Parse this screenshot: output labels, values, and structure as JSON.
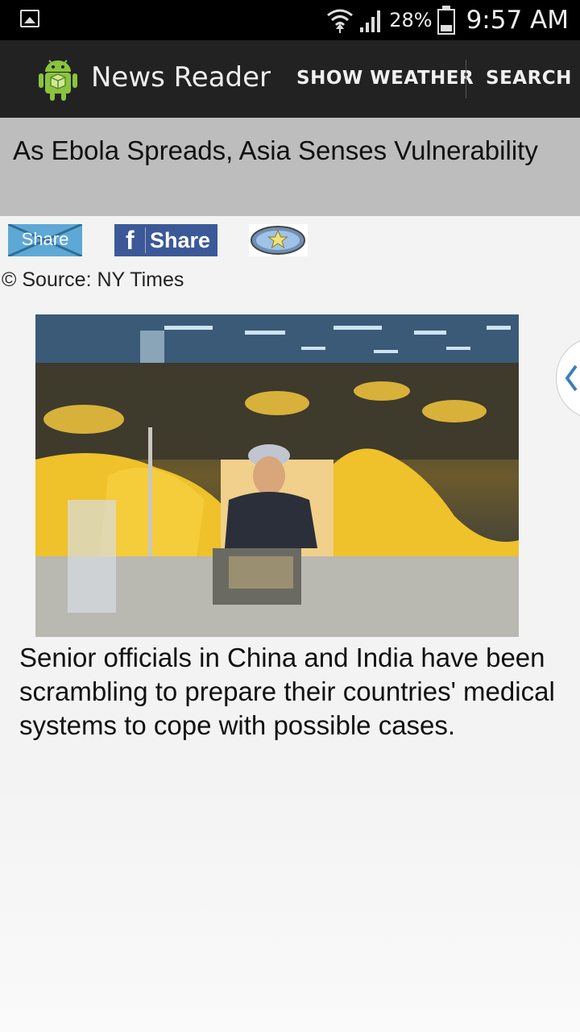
{
  "status_bar": {
    "battery_percent": "28%",
    "time": "9:57 AM",
    "battery_level": 0.28,
    "icons": [
      "gallery-notification-icon",
      "wifi-icon",
      "signal-icon",
      "battery-icon"
    ]
  },
  "action_bar": {
    "app_title": "News Reader",
    "app_icon": "android-icon",
    "show_weather_label": "SHOW WEATHER",
    "search_label": "SEARCH"
  },
  "article": {
    "headline": "As Ebola Spreads, Asia Senses Vulnerability",
    "twitter_share_label": "Share",
    "facebook_f": "f",
    "facebook_share_label": "Share",
    "favorite_icon": "star-icon",
    "source": "© Source: NY Times",
    "summary": "Senior officials in China and India have been scrambling to prepare their countries' medical systems to cope with possible cases."
  },
  "colors": {
    "status_bar_bg": "#000000",
    "action_bar_bg": "#222222",
    "headline_bg": "#bdbdbd",
    "page_bg": "#f3f3f3",
    "twitter_blue": "#5ea8d6",
    "facebook_blue": "#3b5998"
  }
}
